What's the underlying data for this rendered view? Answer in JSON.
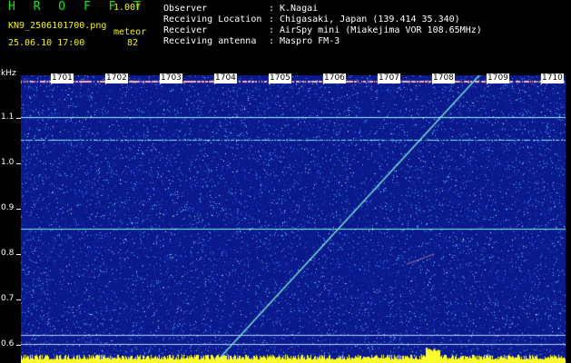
{
  "header": {
    "app_title": "H R O F F T",
    "version": "1.00f",
    "filename": "KN9_2506101700.png",
    "datetime": "25.06.10 17:00",
    "meteor_label": "meteor",
    "meteor_count": "82",
    "fields": [
      {
        "key": "Observer",
        "sep": ":",
        "value": "K.Nagai"
      },
      {
        "key": "Receiving Location",
        "sep": ":",
        "value": "Chigasaki, Japan (139.414 35.340)"
      },
      {
        "key": "Receiver",
        "sep": ":",
        "value": "AirSpy mini (Miakejima VOR 108.65MHz)"
      },
      {
        "key": "Receiving antenna",
        "sep": ":",
        "value": "Maspro FM-3"
      }
    ]
  },
  "axis": {
    "unit": "kHz",
    "ticks": [
      "1.1",
      "1.0",
      "0.9",
      "0.8",
      "0.7",
      "0.6"
    ]
  },
  "minute_markers": [
    "1701",
    "1702",
    "1703",
    "1704",
    "1705",
    "1706",
    "1707",
    "1708",
    "1709",
    "1710"
  ],
  "colors": {
    "background": "#0a1a8c",
    "noise": "#4a90ff",
    "signal": "#7cf5d8",
    "header_green": "#18e018",
    "header_yellow": "#f2f20a",
    "bottom_bar": "#ffff30"
  }
}
